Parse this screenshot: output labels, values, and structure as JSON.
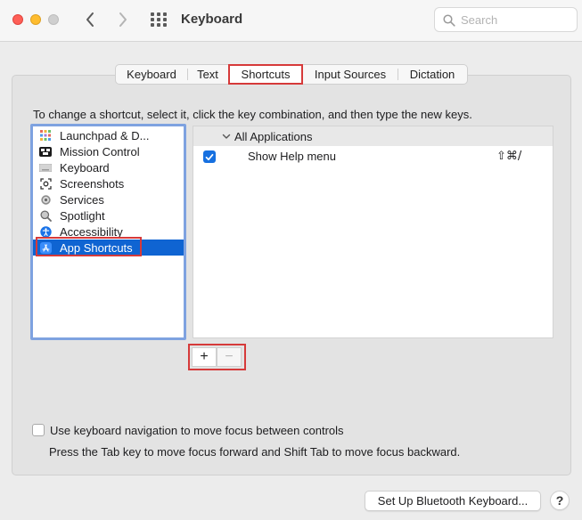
{
  "window": {
    "title": "Keyboard"
  },
  "search": {
    "placeholder": "Search",
    "value": ""
  },
  "tabs": [
    {
      "label": "Keyboard",
      "selected": false
    },
    {
      "label": "Text",
      "selected": false
    },
    {
      "label": "Shortcuts",
      "selected": true
    },
    {
      "label": "Input Sources",
      "selected": false
    },
    {
      "label": "Dictation",
      "selected": false
    }
  ],
  "instruction": "To change a shortcut, select it, click the key combination, and then type the new keys.",
  "categories": [
    {
      "label": "Launchpad & D...",
      "icon": "launchpad-icon",
      "selected": false
    },
    {
      "label": "Mission Control",
      "icon": "mission-control-icon",
      "selected": false
    },
    {
      "label": "Keyboard",
      "icon": "keyboard-icon",
      "selected": false
    },
    {
      "label": "Screenshots",
      "icon": "screenshots-icon",
      "selected": false
    },
    {
      "label": "Services",
      "icon": "services-gear-icon",
      "selected": false
    },
    {
      "label": "Spotlight",
      "icon": "spotlight-icon",
      "selected": false
    },
    {
      "label": "Accessibility",
      "icon": "accessibility-icon",
      "selected": false
    },
    {
      "label": "App Shortcuts",
      "icon": "app-store-icon",
      "selected": true
    }
  ],
  "shortcuts": {
    "group_label": "All Applications",
    "rows": [
      {
        "name": "Show Help menu",
        "keys": "⇧⌘/",
        "enabled": true
      }
    ]
  },
  "add_remove": {
    "add": "+",
    "remove": "−"
  },
  "keyboard_navigation": {
    "label": "Use keyboard navigation to move focus between controls",
    "checked": false,
    "help": "Press the Tab key to move focus forward and Shift Tab to move focus backward."
  },
  "buttons": {
    "bluetooth": "Set Up Bluetooth Keyboard...",
    "help": "?"
  },
  "colors": {
    "selection": "#0f64d2",
    "highlight_annotation": "#d63a3a",
    "focus_ring": "#7ea2e0",
    "checkbox_on": "#1670e0"
  }
}
